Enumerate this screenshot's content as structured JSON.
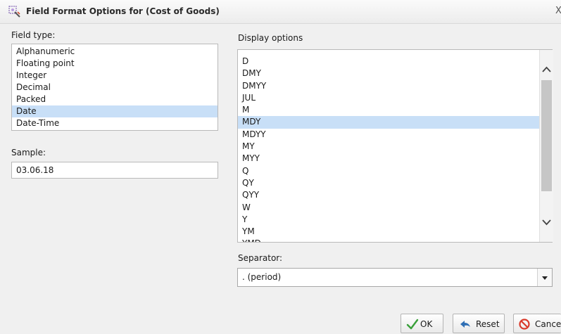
{
  "window": {
    "title": "Field Format Options for (Cost of Goods)",
    "close_glyph": "X"
  },
  "field_type": {
    "label": "Field type:",
    "items": [
      "Alphanumeric",
      "Floating point",
      "Integer",
      "Decimal",
      "Packed",
      "Date",
      "Date-Time"
    ],
    "selected": "Date"
  },
  "sample": {
    "label": "Sample:",
    "value": "03.06.18"
  },
  "display_options": {
    "label": "Display options",
    "items": [
      "D",
      "DMY",
      "DMYY",
      "JUL",
      "M",
      "MDY",
      "MDYY",
      "MY",
      "MYY",
      "Q",
      "QY",
      "QYY",
      "W",
      "Y",
      "YM",
      "YMD"
    ],
    "selected": "MDY"
  },
  "separator": {
    "label": "Separator:",
    "value": ". (period)"
  },
  "buttons": {
    "ok": "OK",
    "reset": "Reset",
    "cancel": "Cancel"
  },
  "colors": {
    "selection": "#c8dff7",
    "ok_check": "#3aa03a",
    "reset_arrow": "#2f6fb5",
    "cancel_icon": "#d93a2b"
  },
  "icons": {
    "title": "field-format-icon",
    "ok": "checkmark-icon",
    "reset": "undo-arrow-icon",
    "cancel": "no-entry-icon",
    "scroll_up": "chevron-up-icon",
    "scroll_down": "chevron-down-icon",
    "combo": "dropdown-arrow-icon"
  }
}
